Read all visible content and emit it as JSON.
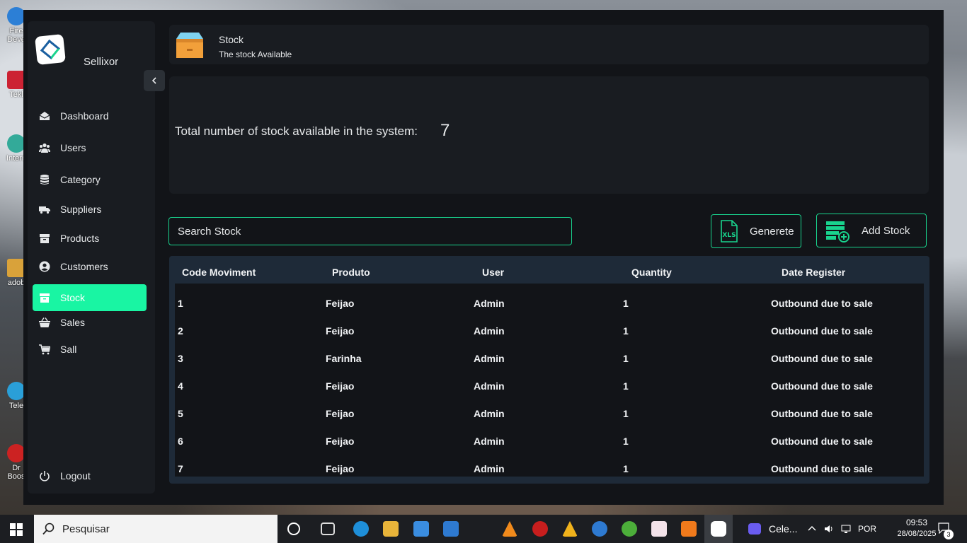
{
  "desktop": {
    "icons": [
      {
        "label": "Fire",
        "sub": "Deve"
      },
      {
        "label": "Tekl"
      },
      {
        "label": "Intern"
      },
      {
        "label": "adob"
      },
      {
        "label": "Tele"
      },
      {
        "label": "Dr",
        "sub": "Boos"
      }
    ]
  },
  "sidebar": {
    "brand": "Sellixor",
    "collapse_icon": "chevron-left-icon",
    "items": [
      {
        "label": "Dashboard",
        "icon": "envelope-open-icon"
      },
      {
        "label": "Users",
        "icon": "users-icon"
      },
      {
        "label": "Category",
        "icon": "database-icon"
      },
      {
        "label": "Suppliers",
        "icon": "truck-icon"
      },
      {
        "label": "Products",
        "icon": "archive-box-icon"
      },
      {
        "label": "Customers",
        "icon": "user-circle-icon"
      },
      {
        "label": "Stock",
        "icon": "archive-box-icon",
        "active": true
      },
      {
        "label": "Sales",
        "icon": "basket-icon"
      },
      {
        "label": "Sall",
        "icon": "cart-icon"
      }
    ],
    "logout": {
      "label": "Logout",
      "icon": "power-icon"
    },
    "accent": "#19f5a3"
  },
  "header": {
    "title": "Stock",
    "subtitle": "The stock Available",
    "icon": "box-icon"
  },
  "summary": {
    "label": "Total number of stock available in the system:",
    "value": "7"
  },
  "search": {
    "placeholder": "Search Stock",
    "value": ""
  },
  "actions": {
    "generate_label": "Generete",
    "add_label": "Add Stock"
  },
  "table": {
    "columns": [
      "Code Moviment",
      "Produto",
      "User",
      "Quantity",
      "Date Register"
    ],
    "rows": [
      [
        "1",
        "Feijao",
        "Admin",
        "1",
        "Outbound due to sale"
      ],
      [
        "2",
        "Feijao",
        "Admin",
        "1",
        "Outbound due to sale"
      ],
      [
        "3",
        "Farinha",
        "Admin",
        "1",
        "Outbound due to sale"
      ],
      [
        "4",
        "Feijao",
        "Admin",
        "1",
        "Outbound due to sale"
      ],
      [
        "5",
        "Feijao",
        "Admin",
        "1",
        "Outbound due to sale"
      ],
      [
        "6",
        "Feijao",
        "Admin",
        "1",
        "Outbound due to sale"
      ],
      [
        "7",
        "Feijao",
        "Admin",
        "1",
        "Outbound due to sale"
      ]
    ]
  },
  "taskbar": {
    "search_placeholder": "Pesquisar",
    "app_label": "Cele...",
    "language": "POR",
    "time": "09:53",
    "date": "28/08/2025",
    "notifications": "3"
  }
}
